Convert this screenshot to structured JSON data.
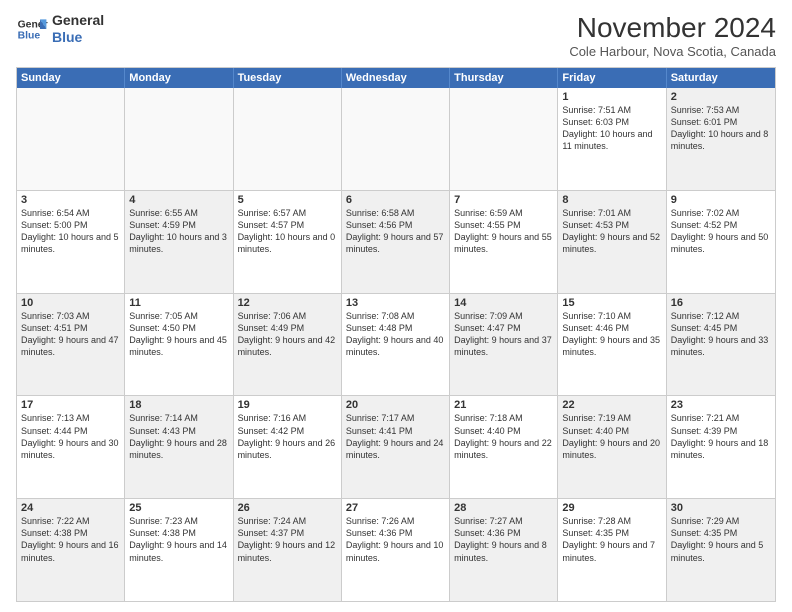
{
  "logo": {
    "line1": "General",
    "line2": "Blue"
  },
  "title": "November 2024",
  "subtitle": "Cole Harbour, Nova Scotia, Canada",
  "dayHeaders": [
    "Sunday",
    "Monday",
    "Tuesday",
    "Wednesday",
    "Thursday",
    "Friday",
    "Saturday"
  ],
  "rows": [
    [
      {
        "day": "",
        "info": "",
        "empty": true
      },
      {
        "day": "",
        "info": "",
        "empty": true
      },
      {
        "day": "",
        "info": "",
        "empty": true
      },
      {
        "day": "",
        "info": "",
        "empty": true
      },
      {
        "day": "",
        "info": "",
        "empty": true
      },
      {
        "day": "1",
        "info": "Sunrise: 7:51 AM\nSunset: 6:03 PM\nDaylight: 10 hours and 11 minutes.",
        "empty": false,
        "shaded": false
      },
      {
        "day": "2",
        "info": "Sunrise: 7:53 AM\nSunset: 6:01 PM\nDaylight: 10 hours and 8 minutes.",
        "empty": false,
        "shaded": true
      }
    ],
    [
      {
        "day": "3",
        "info": "Sunrise: 6:54 AM\nSunset: 5:00 PM\nDaylight: 10 hours and 5 minutes.",
        "empty": false,
        "shaded": false
      },
      {
        "day": "4",
        "info": "Sunrise: 6:55 AM\nSunset: 4:59 PM\nDaylight: 10 hours and 3 minutes.",
        "empty": false,
        "shaded": true
      },
      {
        "day": "5",
        "info": "Sunrise: 6:57 AM\nSunset: 4:57 PM\nDaylight: 10 hours and 0 minutes.",
        "empty": false,
        "shaded": false
      },
      {
        "day": "6",
        "info": "Sunrise: 6:58 AM\nSunset: 4:56 PM\nDaylight: 9 hours and 57 minutes.",
        "empty": false,
        "shaded": true
      },
      {
        "day": "7",
        "info": "Sunrise: 6:59 AM\nSunset: 4:55 PM\nDaylight: 9 hours and 55 minutes.",
        "empty": false,
        "shaded": false
      },
      {
        "day": "8",
        "info": "Sunrise: 7:01 AM\nSunset: 4:53 PM\nDaylight: 9 hours and 52 minutes.",
        "empty": false,
        "shaded": true
      },
      {
        "day": "9",
        "info": "Sunrise: 7:02 AM\nSunset: 4:52 PM\nDaylight: 9 hours and 50 minutes.",
        "empty": false,
        "shaded": false
      }
    ],
    [
      {
        "day": "10",
        "info": "Sunrise: 7:03 AM\nSunset: 4:51 PM\nDaylight: 9 hours and 47 minutes.",
        "empty": false,
        "shaded": true
      },
      {
        "day": "11",
        "info": "Sunrise: 7:05 AM\nSunset: 4:50 PM\nDaylight: 9 hours and 45 minutes.",
        "empty": false,
        "shaded": false
      },
      {
        "day": "12",
        "info": "Sunrise: 7:06 AM\nSunset: 4:49 PM\nDaylight: 9 hours and 42 minutes.",
        "empty": false,
        "shaded": true
      },
      {
        "day": "13",
        "info": "Sunrise: 7:08 AM\nSunset: 4:48 PM\nDaylight: 9 hours and 40 minutes.",
        "empty": false,
        "shaded": false
      },
      {
        "day": "14",
        "info": "Sunrise: 7:09 AM\nSunset: 4:47 PM\nDaylight: 9 hours and 37 minutes.",
        "empty": false,
        "shaded": true
      },
      {
        "day": "15",
        "info": "Sunrise: 7:10 AM\nSunset: 4:46 PM\nDaylight: 9 hours and 35 minutes.",
        "empty": false,
        "shaded": false
      },
      {
        "day": "16",
        "info": "Sunrise: 7:12 AM\nSunset: 4:45 PM\nDaylight: 9 hours and 33 minutes.",
        "empty": false,
        "shaded": true
      }
    ],
    [
      {
        "day": "17",
        "info": "Sunrise: 7:13 AM\nSunset: 4:44 PM\nDaylight: 9 hours and 30 minutes.",
        "empty": false,
        "shaded": false
      },
      {
        "day": "18",
        "info": "Sunrise: 7:14 AM\nSunset: 4:43 PM\nDaylight: 9 hours and 28 minutes.",
        "empty": false,
        "shaded": true
      },
      {
        "day": "19",
        "info": "Sunrise: 7:16 AM\nSunset: 4:42 PM\nDaylight: 9 hours and 26 minutes.",
        "empty": false,
        "shaded": false
      },
      {
        "day": "20",
        "info": "Sunrise: 7:17 AM\nSunset: 4:41 PM\nDaylight: 9 hours and 24 minutes.",
        "empty": false,
        "shaded": true
      },
      {
        "day": "21",
        "info": "Sunrise: 7:18 AM\nSunset: 4:40 PM\nDaylight: 9 hours and 22 minutes.",
        "empty": false,
        "shaded": false
      },
      {
        "day": "22",
        "info": "Sunrise: 7:19 AM\nSunset: 4:40 PM\nDaylight: 9 hours and 20 minutes.",
        "empty": false,
        "shaded": true
      },
      {
        "day": "23",
        "info": "Sunrise: 7:21 AM\nSunset: 4:39 PM\nDaylight: 9 hours and 18 minutes.",
        "empty": false,
        "shaded": false
      }
    ],
    [
      {
        "day": "24",
        "info": "Sunrise: 7:22 AM\nSunset: 4:38 PM\nDaylight: 9 hours and 16 minutes.",
        "empty": false,
        "shaded": true
      },
      {
        "day": "25",
        "info": "Sunrise: 7:23 AM\nSunset: 4:38 PM\nDaylight: 9 hours and 14 minutes.",
        "empty": false,
        "shaded": false
      },
      {
        "day": "26",
        "info": "Sunrise: 7:24 AM\nSunset: 4:37 PM\nDaylight: 9 hours and 12 minutes.",
        "empty": false,
        "shaded": true
      },
      {
        "day": "27",
        "info": "Sunrise: 7:26 AM\nSunset: 4:36 PM\nDaylight: 9 hours and 10 minutes.",
        "empty": false,
        "shaded": false
      },
      {
        "day": "28",
        "info": "Sunrise: 7:27 AM\nSunset: 4:36 PM\nDaylight: 9 hours and 8 minutes.",
        "empty": false,
        "shaded": true
      },
      {
        "day": "29",
        "info": "Sunrise: 7:28 AM\nSunset: 4:35 PM\nDaylight: 9 hours and 7 minutes.",
        "empty": false,
        "shaded": false
      },
      {
        "day": "30",
        "info": "Sunrise: 7:29 AM\nSunset: 4:35 PM\nDaylight: 9 hours and 5 minutes.",
        "empty": false,
        "shaded": true
      }
    ]
  ]
}
